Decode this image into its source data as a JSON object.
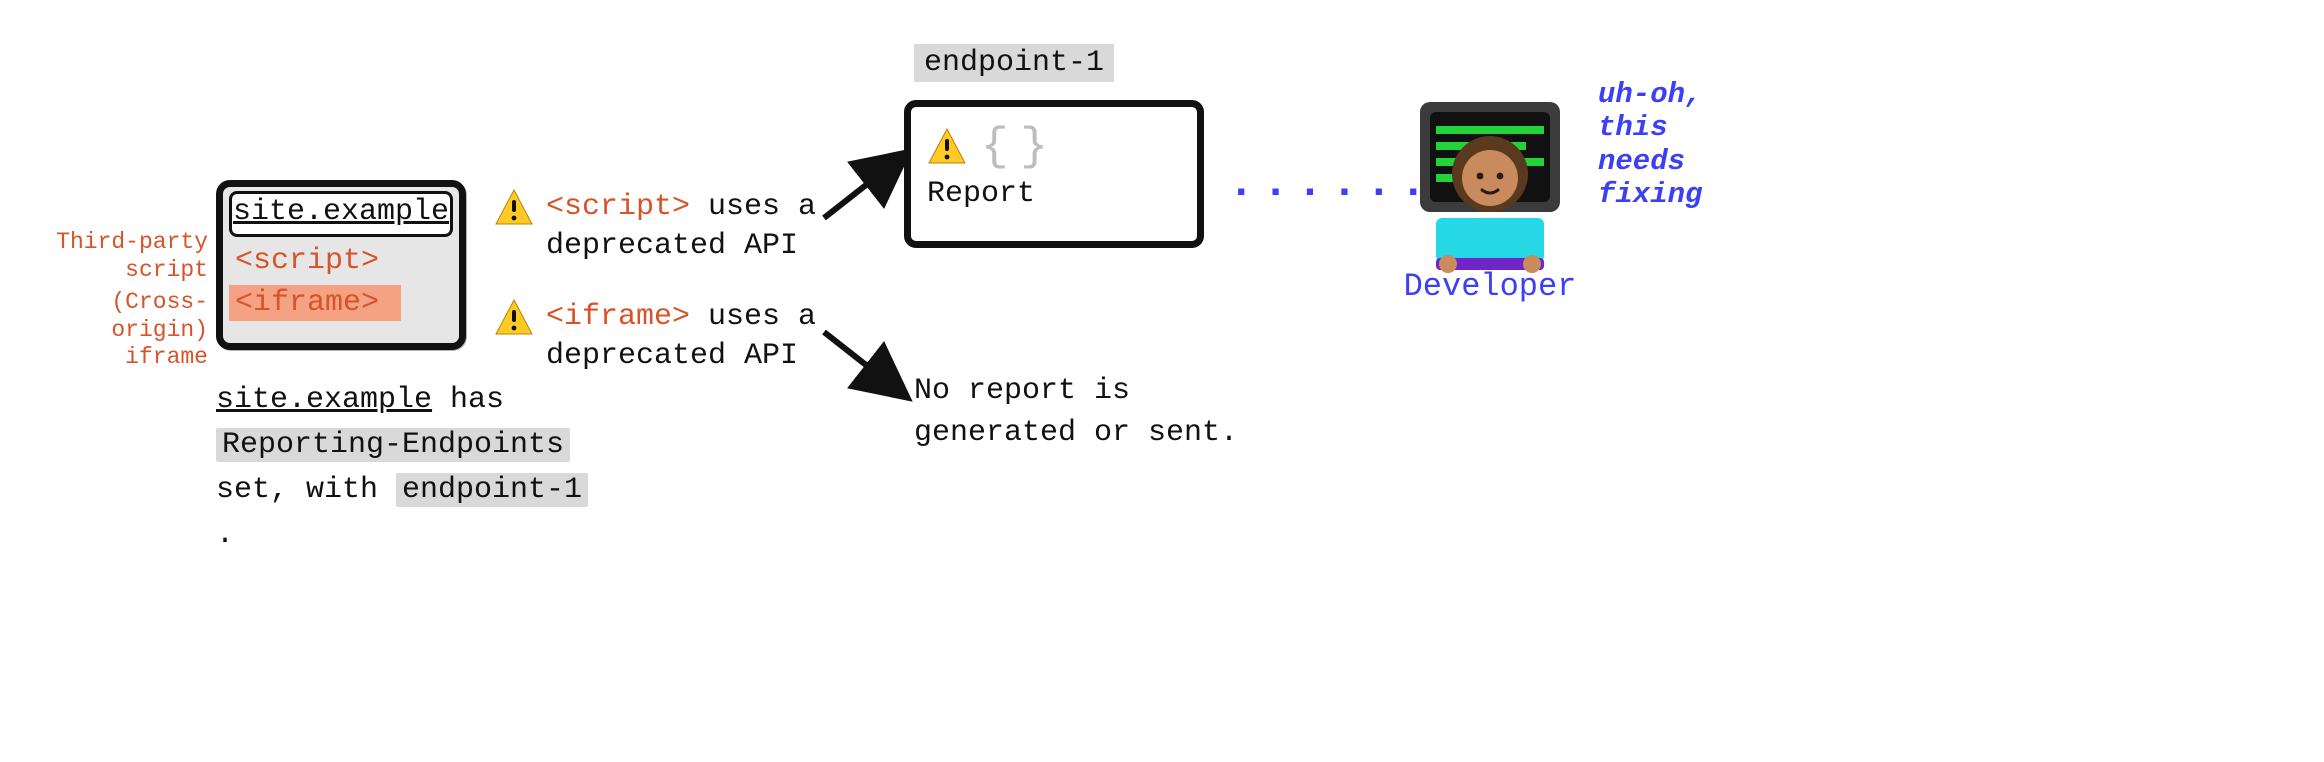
{
  "diagram": {
    "browser": {
      "url": "site.example",
      "rows": {
        "script": "<script>",
        "iframe": "<iframe>"
      }
    },
    "side_labels": {
      "third_party": "Third-party script",
      "cross_origin": "(Cross-origin) iframe"
    },
    "site_caption": {
      "text1": "site.example",
      "text2": " has ",
      "code1": "Reporting-Endpoints",
      "text3": " set, with ",
      "code2": "endpoint-1",
      "text4": " ."
    },
    "warnings": {
      "script": {
        "tag": "<script>",
        "rest": " uses a deprecated API"
      },
      "iframe": {
        "tag": "<iframe>",
        "rest": " uses a deprecated API"
      }
    },
    "endpoint": {
      "name": "endpoint-1",
      "report_label": "Report"
    },
    "no_report": "No report is generated or sent.",
    "developer": {
      "label": "Developer",
      "thought": "uh-oh, this needs fixing"
    },
    "dots": "······"
  }
}
